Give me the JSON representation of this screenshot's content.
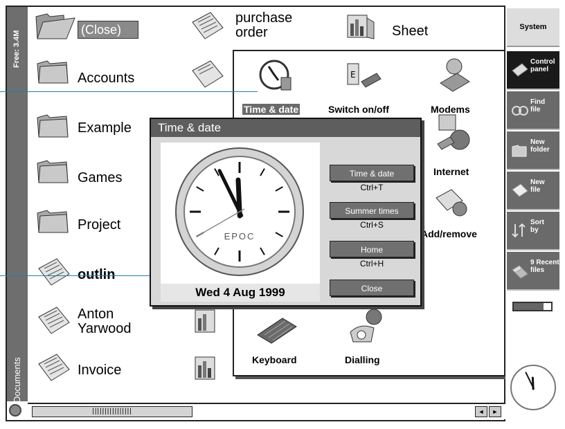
{
  "leftbar": {
    "free_memory": "Free: 3.4M",
    "folder_name": "Documents"
  },
  "desktop": {
    "close_label": "(Close)",
    "folders": [
      "Accounts",
      "Example",
      "Games",
      "Project"
    ],
    "docs": [
      "outlin",
      "Anton\nYarwood",
      "Invoice"
    ],
    "top_items": [
      "purchase\norder",
      "Sheet"
    ]
  },
  "control_panel": {
    "items": [
      "Time & date",
      "Switch on/off",
      "Modems",
      "Internet",
      "Add/remove",
      "Keyboard",
      "Dialling"
    ]
  },
  "dialog": {
    "title": "Time & date",
    "clock_brand": "EPOC",
    "date": "Wed 4 Aug 1999",
    "buttons": [
      {
        "label": "Time & date",
        "shortcut": "Ctrl+T"
      },
      {
        "label": "Summer times",
        "shortcut": "Ctrl+S"
      },
      {
        "label": "Home",
        "shortcut": "Ctrl+H"
      },
      {
        "label": "Close",
        "shortcut": ""
      }
    ],
    "time": {
      "hour": 11,
      "minute": 55,
      "second": 40
    }
  },
  "sidebar": {
    "system": "System",
    "buttons": [
      {
        "label": "Control\npanel",
        "icon": "control-panel-icon"
      },
      {
        "label": "Find\nfile",
        "icon": "binoculars-icon"
      },
      {
        "label": "New\nfolder",
        "icon": "folder-icon"
      },
      {
        "label": "New\nfile",
        "icon": "new-file-icon"
      },
      {
        "label": "Sort\nby",
        "icon": "sort-icon"
      },
      {
        "label": "9 Recent\nfiles",
        "icon": "recent-files-icon"
      }
    ],
    "battery_level": 0.8
  },
  "colors": {
    "accent": "#1e7fb0",
    "dark": "#5e5e5e",
    "panel": "#d8d8d8"
  }
}
